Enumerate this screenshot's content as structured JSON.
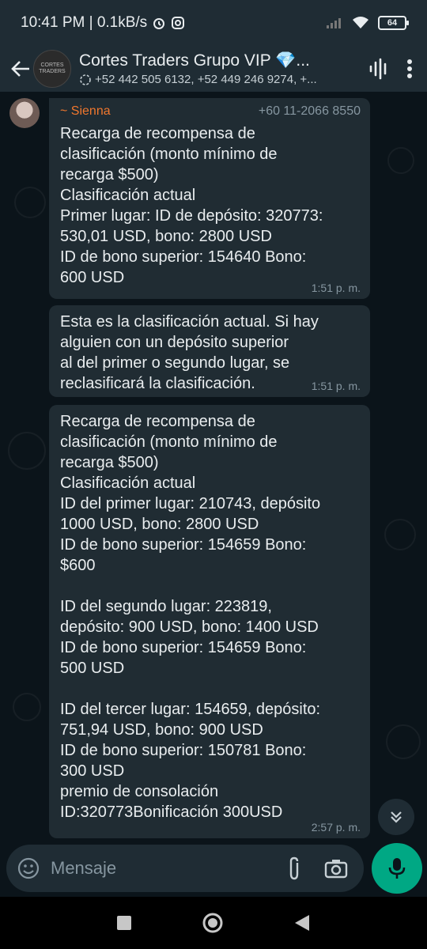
{
  "status_bar": {
    "time_speed": "10:41 PM | 0.1kB/s",
    "battery": "64"
  },
  "header": {
    "title": "Cortes Traders Grupo VIP 💎...",
    "subtitle": "+52 442 505 6132, +52 449 246 9274, +...",
    "avatar_text": "CORTES TRADERS"
  },
  "messages": [
    {
      "sender": "~ Sienna",
      "phone": "+60 11-2066 8550",
      "text": "Recarga de recompensa de\nclasificación (monto mínimo de\nrecarga $500)\nClasificación actual\nPrimer lugar: ID de depósito: 320773:\n530,01 USD, bono: 2800 USD\nID de bono superior: 154640 Bono:\n600 USD",
      "time": "1:51 p. m."
    },
    {
      "text": "Esta es la clasificación actual. Si hay\nalguien con un depósito superior\nal del primer o segundo lugar, se\nreclasificará la clasificación.",
      "time": "1:51 p. m."
    },
    {
      "text": "Recarga de recompensa de\nclasificación (monto mínimo de\nrecarga $500)\nClasificación actual\nID del primer lugar: 210743, depósito\n1000 USD, bono: 2800 USD\nID de bono superior: 154659 Bono:\n$600\n\nID del segundo lugar: 223819,\ndepósito: 900 USD, bono: 1400 USD\nID de bono superior: 154659 Bono:\n500 USD\n\nID del tercer lugar: 154659, depósito:\n751,94 USD, bono: 900 USD\nID de bono superior: 150781 Bono:\n300 USD\npremio de consolación\nID:320773Bonificación 300USD",
      "time": "2:57 p. m."
    }
  ],
  "composer": {
    "placeholder": "Mensaje"
  },
  "colors": {
    "background": "#0b141a",
    "bubble": "#202c33",
    "bar": "#1f2c34",
    "accent": "#00a884",
    "sender_name": "#f0772e"
  },
  "icons": [
    "back-arrow-icon",
    "voice-chat-icon",
    "more-options-icon",
    "emoji-icon",
    "attach-icon",
    "camera-icon",
    "mic-icon",
    "scroll-down-icon",
    "home-icon",
    "recents-icon",
    "back-nav-icon"
  ]
}
